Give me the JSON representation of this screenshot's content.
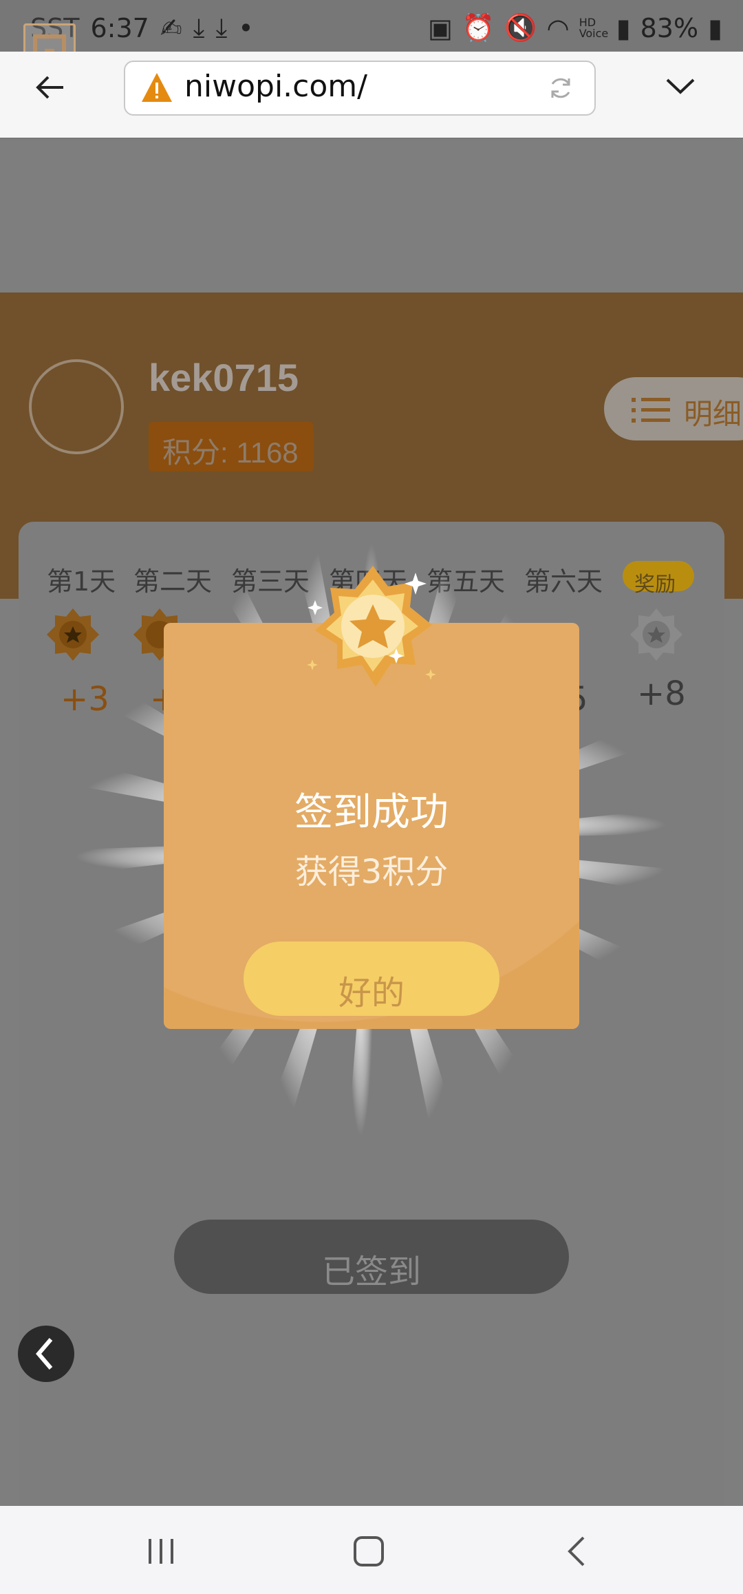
{
  "status_bar": {
    "time": "6:37",
    "carrier_prefix": "SST",
    "battery": "83%",
    "hd_voice": "HD Voice"
  },
  "browser": {
    "url": "niwopi.com/"
  },
  "profile": {
    "username": "kek0715",
    "points_label": "积分: 1168",
    "detail_label": "明细"
  },
  "checkin": {
    "days": [
      {
        "label": "第1天",
        "reward": "+3"
      },
      {
        "label": "第二天",
        "reward": "+"
      },
      {
        "label": "第三天",
        "reward": ""
      },
      {
        "label": "第四天",
        "reward": ""
      },
      {
        "label": "第五天",
        "reward": ""
      },
      {
        "label": "第六天",
        "reward": "5"
      },
      {
        "label": "奖励",
        "reward": "+8"
      }
    ],
    "signed_label": "已签到"
  },
  "modal": {
    "title": "签到成功",
    "subtitle": "获得3积分",
    "ok_label": "好的"
  },
  "colors": {
    "accent_orange": "#e1a55a",
    "button_yellow": "#f5ce66",
    "reward_text": "#8a4f10",
    "band_brown": "#70512b"
  }
}
